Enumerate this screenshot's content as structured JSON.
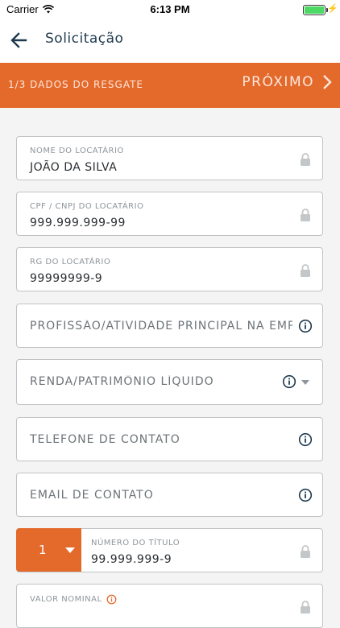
{
  "statusbar": {
    "carrier": "Carrier",
    "time": "6:13 PM"
  },
  "navbar": {
    "title": "Solicitação"
  },
  "step": {
    "label": "1/3 DADOS DO RESGATE",
    "next_label": "PRÓXIMO"
  },
  "fields": {
    "nome": {
      "label": "NOME DO LOCATÁRIO",
      "value": "JOÃO DA SILVA"
    },
    "cpf": {
      "label": "CPF / CNPJ DO LOCATÁRIO",
      "value": "999.999.999-99"
    },
    "rg": {
      "label": "RG DO LOCATÁRIO",
      "value": "99999999-9"
    },
    "profissao": {
      "placeholder": "PROFISSÃO/ATIVIDADE PRINCIPAL NA EMPRESA"
    },
    "renda": {
      "placeholder": "RENDA/PATRIMÔNIO LÍQUIDO"
    },
    "telefone": {
      "placeholder": "TELEFONE DE CONTATO"
    },
    "email": {
      "placeholder": "EMAIL DE CONTATO"
    },
    "titulo": {
      "count": "1",
      "label": "NÚMERO DO TÍTULO",
      "value": "99.999.999-9"
    },
    "valor": {
      "label": "VALOR NOMINAL"
    }
  },
  "colors": {
    "accent": "#e46a2c",
    "title": "#1f3a4f",
    "border": "#bfc3c6"
  }
}
